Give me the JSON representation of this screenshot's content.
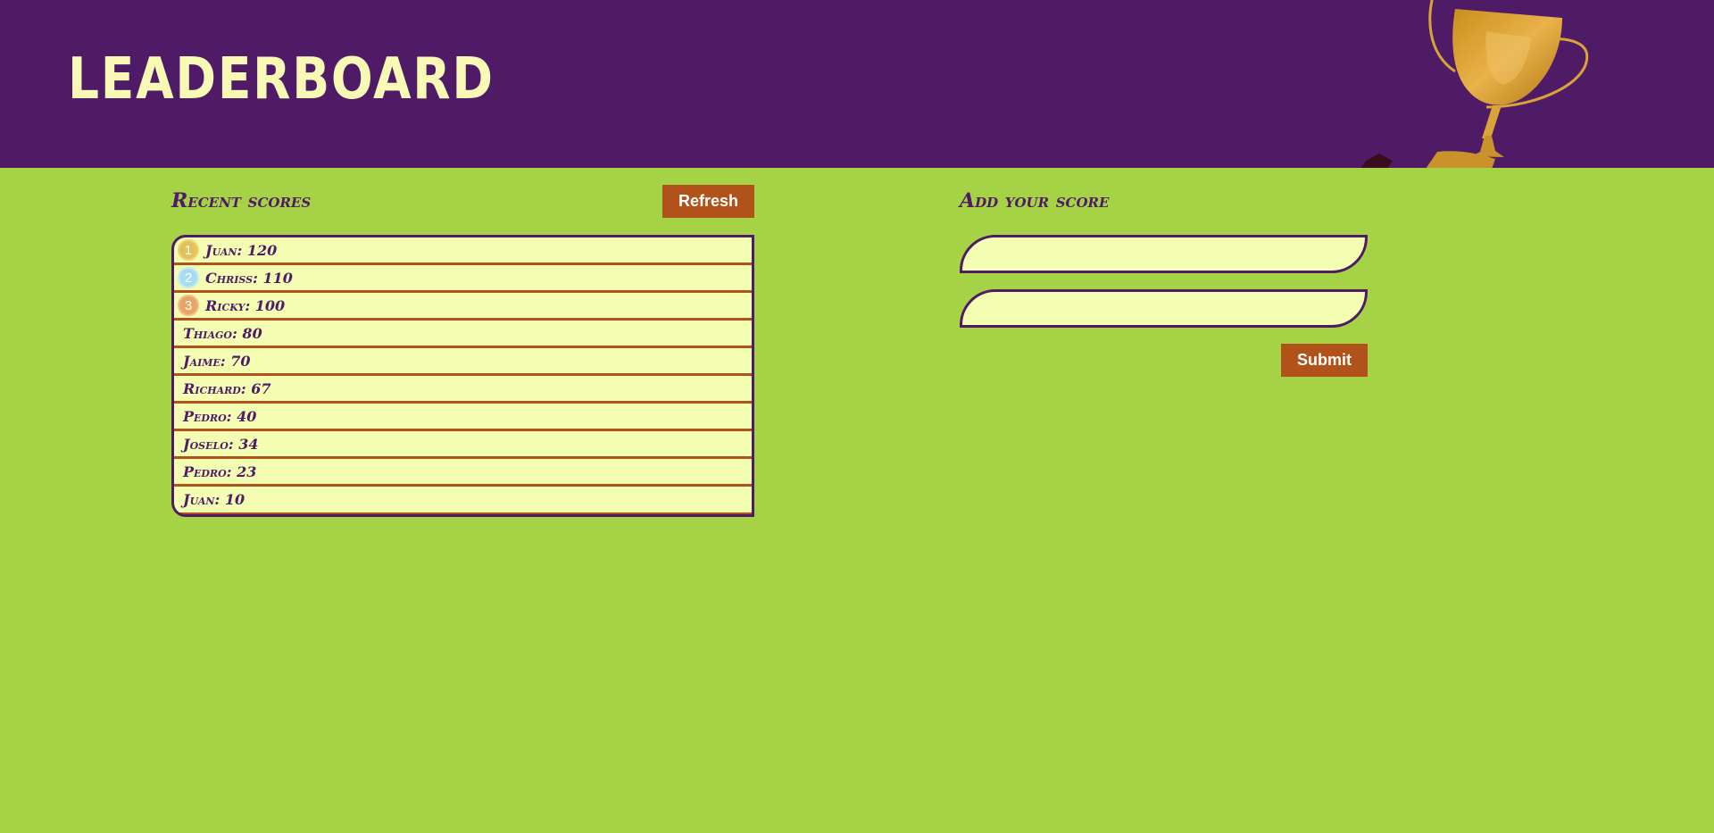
{
  "header": {
    "title": "LEADERBOARD"
  },
  "recent_scores": {
    "title": "Recent scores",
    "refresh_label": "Refresh",
    "entries": [
      {
        "rank": "1",
        "text": "Juan: 120"
      },
      {
        "rank": "2",
        "text": "Chriss: 110"
      },
      {
        "rank": "3",
        "text": "Ricky: 100"
      },
      {
        "text": "Thiago: 80"
      },
      {
        "text": "Jaime: 70"
      },
      {
        "text": "Richard: 67"
      },
      {
        "text": "Pedro: 40"
      },
      {
        "text": "Joselo: 34"
      },
      {
        "text": "Pedro: 23"
      },
      {
        "text": "Juan: 10"
      }
    ]
  },
  "add_score": {
    "title": "Add your score",
    "name_field": {
      "value": "",
      "placeholder": ""
    },
    "score_field": {
      "value": "",
      "placeholder": ""
    },
    "submit_label": "Submit"
  },
  "colors": {
    "header_bg": "#4f1a66",
    "page_bg": "#a6d345",
    "button_bg": "#b1521a",
    "row_bg": "#f3feb3",
    "title_text": "#f7f9b5"
  },
  "icons": [
    "trophy-icon",
    "gold-medal-icon",
    "silver-medal-icon",
    "bronze-medal-icon"
  ]
}
